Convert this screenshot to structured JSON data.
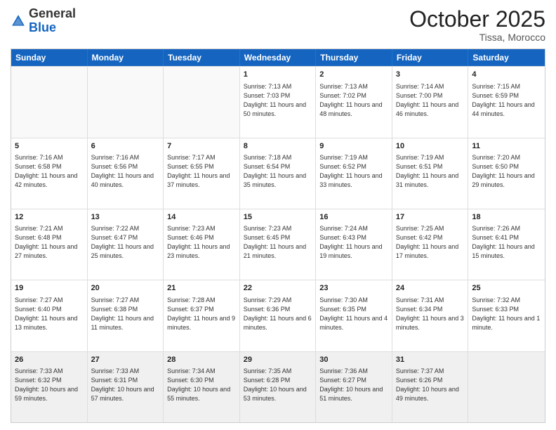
{
  "header": {
    "logo": {
      "general": "General",
      "blue": "Blue"
    },
    "month": "October 2025",
    "location": "Tissa, Morocco"
  },
  "days": [
    "Sunday",
    "Monday",
    "Tuesday",
    "Wednesday",
    "Thursday",
    "Friday",
    "Saturday"
  ],
  "weeks": [
    [
      {
        "day": "",
        "sunrise": "",
        "sunset": "",
        "daylight": "",
        "empty": true
      },
      {
        "day": "",
        "sunrise": "",
        "sunset": "",
        "daylight": "",
        "empty": true
      },
      {
        "day": "",
        "sunrise": "",
        "sunset": "",
        "daylight": "",
        "empty": true
      },
      {
        "day": "1",
        "sunrise": "Sunrise: 7:13 AM",
        "sunset": "Sunset: 7:03 PM",
        "daylight": "Daylight: 11 hours and 50 minutes.",
        "empty": false
      },
      {
        "day": "2",
        "sunrise": "Sunrise: 7:13 AM",
        "sunset": "Sunset: 7:02 PM",
        "daylight": "Daylight: 11 hours and 48 minutes.",
        "empty": false
      },
      {
        "day": "3",
        "sunrise": "Sunrise: 7:14 AM",
        "sunset": "Sunset: 7:00 PM",
        "daylight": "Daylight: 11 hours and 46 minutes.",
        "empty": false
      },
      {
        "day": "4",
        "sunrise": "Sunrise: 7:15 AM",
        "sunset": "Sunset: 6:59 PM",
        "daylight": "Daylight: 11 hours and 44 minutes.",
        "empty": false
      }
    ],
    [
      {
        "day": "5",
        "sunrise": "Sunrise: 7:16 AM",
        "sunset": "Sunset: 6:58 PM",
        "daylight": "Daylight: 11 hours and 42 minutes.",
        "empty": false
      },
      {
        "day": "6",
        "sunrise": "Sunrise: 7:16 AM",
        "sunset": "Sunset: 6:56 PM",
        "daylight": "Daylight: 11 hours and 40 minutes.",
        "empty": false
      },
      {
        "day": "7",
        "sunrise": "Sunrise: 7:17 AM",
        "sunset": "Sunset: 6:55 PM",
        "daylight": "Daylight: 11 hours and 37 minutes.",
        "empty": false
      },
      {
        "day": "8",
        "sunrise": "Sunrise: 7:18 AM",
        "sunset": "Sunset: 6:54 PM",
        "daylight": "Daylight: 11 hours and 35 minutes.",
        "empty": false
      },
      {
        "day": "9",
        "sunrise": "Sunrise: 7:19 AM",
        "sunset": "Sunset: 6:52 PM",
        "daylight": "Daylight: 11 hours and 33 minutes.",
        "empty": false
      },
      {
        "day": "10",
        "sunrise": "Sunrise: 7:19 AM",
        "sunset": "Sunset: 6:51 PM",
        "daylight": "Daylight: 11 hours and 31 minutes.",
        "empty": false
      },
      {
        "day": "11",
        "sunrise": "Sunrise: 7:20 AM",
        "sunset": "Sunset: 6:50 PM",
        "daylight": "Daylight: 11 hours and 29 minutes.",
        "empty": false
      }
    ],
    [
      {
        "day": "12",
        "sunrise": "Sunrise: 7:21 AM",
        "sunset": "Sunset: 6:48 PM",
        "daylight": "Daylight: 11 hours and 27 minutes.",
        "empty": false
      },
      {
        "day": "13",
        "sunrise": "Sunrise: 7:22 AM",
        "sunset": "Sunset: 6:47 PM",
        "daylight": "Daylight: 11 hours and 25 minutes.",
        "empty": false
      },
      {
        "day": "14",
        "sunrise": "Sunrise: 7:23 AM",
        "sunset": "Sunset: 6:46 PM",
        "daylight": "Daylight: 11 hours and 23 minutes.",
        "empty": false
      },
      {
        "day": "15",
        "sunrise": "Sunrise: 7:23 AM",
        "sunset": "Sunset: 6:45 PM",
        "daylight": "Daylight: 11 hours and 21 minutes.",
        "empty": false
      },
      {
        "day": "16",
        "sunrise": "Sunrise: 7:24 AM",
        "sunset": "Sunset: 6:43 PM",
        "daylight": "Daylight: 11 hours and 19 minutes.",
        "empty": false
      },
      {
        "day": "17",
        "sunrise": "Sunrise: 7:25 AM",
        "sunset": "Sunset: 6:42 PM",
        "daylight": "Daylight: 11 hours and 17 minutes.",
        "empty": false
      },
      {
        "day": "18",
        "sunrise": "Sunrise: 7:26 AM",
        "sunset": "Sunset: 6:41 PM",
        "daylight": "Daylight: 11 hours and 15 minutes.",
        "empty": false
      }
    ],
    [
      {
        "day": "19",
        "sunrise": "Sunrise: 7:27 AM",
        "sunset": "Sunset: 6:40 PM",
        "daylight": "Daylight: 11 hours and 13 minutes.",
        "empty": false
      },
      {
        "day": "20",
        "sunrise": "Sunrise: 7:27 AM",
        "sunset": "Sunset: 6:38 PM",
        "daylight": "Daylight: 11 hours and 11 minutes.",
        "empty": false
      },
      {
        "day": "21",
        "sunrise": "Sunrise: 7:28 AM",
        "sunset": "Sunset: 6:37 PM",
        "daylight": "Daylight: 11 hours and 9 minutes.",
        "empty": false
      },
      {
        "day": "22",
        "sunrise": "Sunrise: 7:29 AM",
        "sunset": "Sunset: 6:36 PM",
        "daylight": "Daylight: 11 hours and 6 minutes.",
        "empty": false
      },
      {
        "day": "23",
        "sunrise": "Sunrise: 7:30 AM",
        "sunset": "Sunset: 6:35 PM",
        "daylight": "Daylight: 11 hours and 4 minutes.",
        "empty": false
      },
      {
        "day": "24",
        "sunrise": "Sunrise: 7:31 AM",
        "sunset": "Sunset: 6:34 PM",
        "daylight": "Daylight: 11 hours and 3 minutes.",
        "empty": false
      },
      {
        "day": "25",
        "sunrise": "Sunrise: 7:32 AM",
        "sunset": "Sunset: 6:33 PM",
        "daylight": "Daylight: 11 hours and 1 minute.",
        "empty": false
      }
    ],
    [
      {
        "day": "26",
        "sunrise": "Sunrise: 7:33 AM",
        "sunset": "Sunset: 6:32 PM",
        "daylight": "Daylight: 10 hours and 59 minutes.",
        "empty": false
      },
      {
        "day": "27",
        "sunrise": "Sunrise: 7:33 AM",
        "sunset": "Sunset: 6:31 PM",
        "daylight": "Daylight: 10 hours and 57 minutes.",
        "empty": false
      },
      {
        "day": "28",
        "sunrise": "Sunrise: 7:34 AM",
        "sunset": "Sunset: 6:30 PM",
        "daylight": "Daylight: 10 hours and 55 minutes.",
        "empty": false
      },
      {
        "day": "29",
        "sunrise": "Sunrise: 7:35 AM",
        "sunset": "Sunset: 6:28 PM",
        "daylight": "Daylight: 10 hours and 53 minutes.",
        "empty": false
      },
      {
        "day": "30",
        "sunrise": "Sunrise: 7:36 AM",
        "sunset": "Sunset: 6:27 PM",
        "daylight": "Daylight: 10 hours and 51 minutes.",
        "empty": false
      },
      {
        "day": "31",
        "sunrise": "Sunrise: 7:37 AM",
        "sunset": "Sunset: 6:26 PM",
        "daylight": "Daylight: 10 hours and 49 minutes.",
        "empty": false
      },
      {
        "day": "",
        "sunrise": "",
        "sunset": "",
        "daylight": "",
        "empty": true
      }
    ]
  ]
}
